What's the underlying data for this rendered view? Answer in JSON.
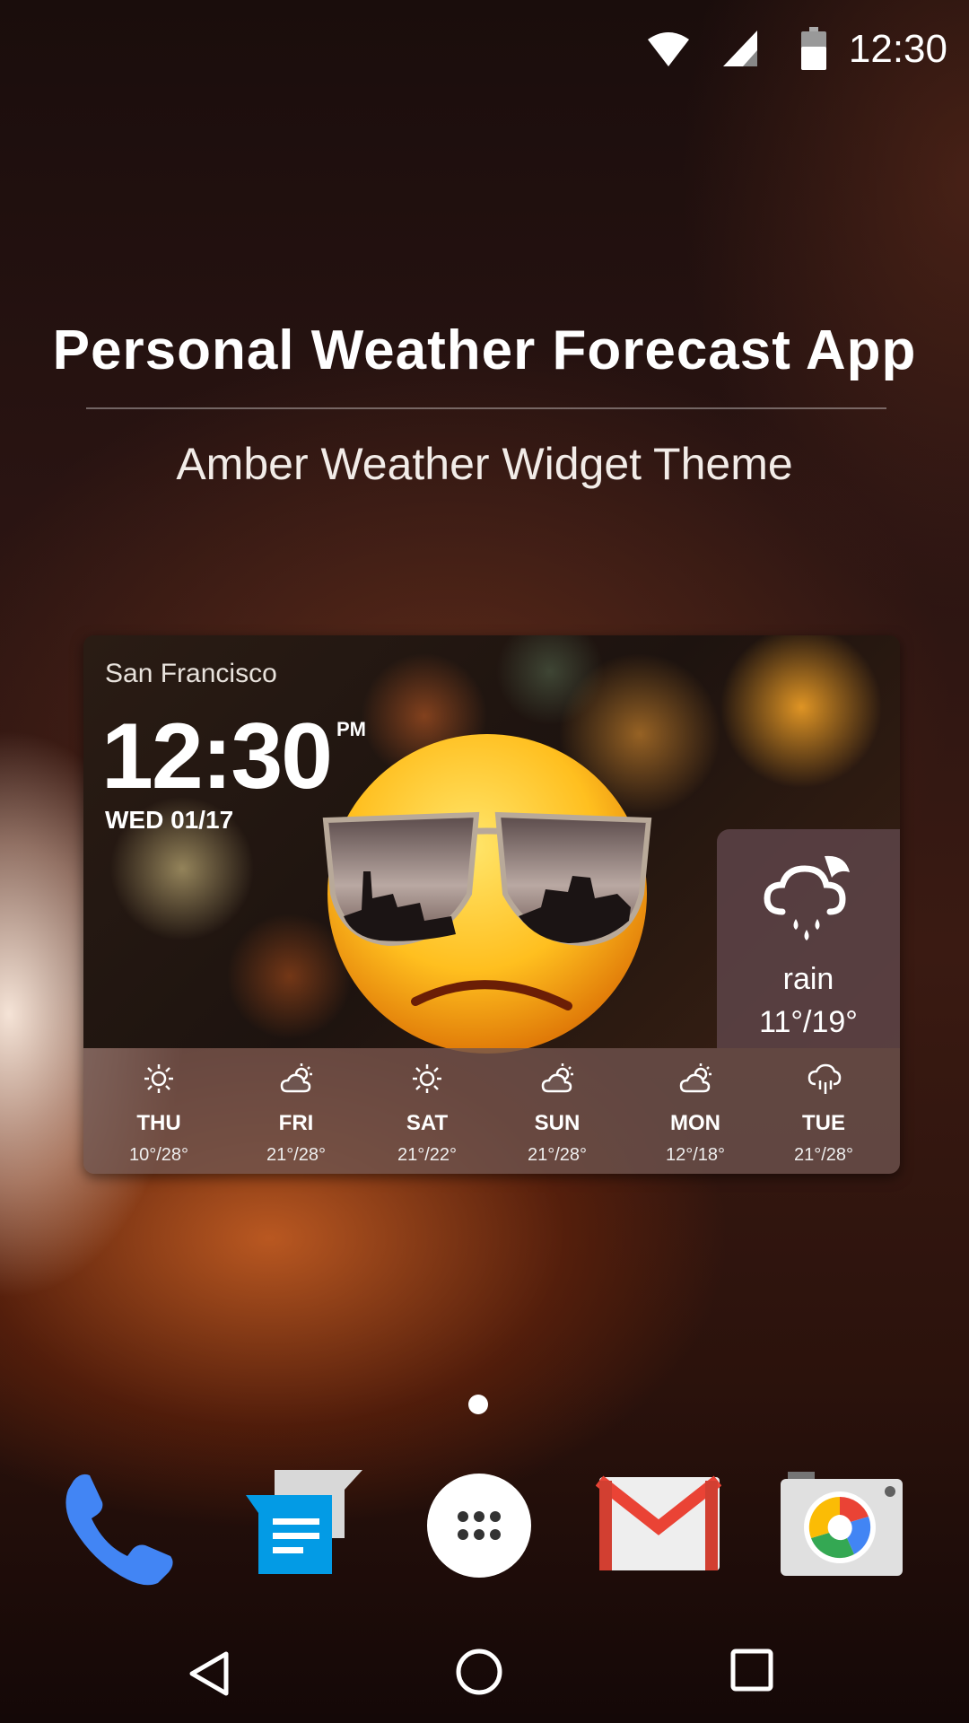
{
  "status_bar": {
    "time": "12:30",
    "icons": [
      "wifi-icon",
      "cell-signal-icon",
      "battery-icon"
    ]
  },
  "promo": {
    "title": "Personal Weather Forecast App",
    "subtitle": "Amber Weather Widget Theme"
  },
  "widget": {
    "city": "San Francisco",
    "time": "12:30",
    "ampm": "PM",
    "date": "WED 01/17",
    "current": {
      "icon": "rain-cloud-moon-icon",
      "condition": "rain",
      "temp_range": "11°/19°"
    },
    "forecast": [
      {
        "day": "THU",
        "temps": "10°/28°",
        "icon": "sun-icon"
      },
      {
        "day": "FRI",
        "temps": "21°/28°",
        "icon": "partly-cloudy-icon"
      },
      {
        "day": "SAT",
        "temps": "21°/22°",
        "icon": "sun-icon"
      },
      {
        "day": "SUN",
        "temps": "21°/28°",
        "icon": "partly-cloudy-icon"
      },
      {
        "day": "MON",
        "temps": "12°/18°",
        "icon": "partly-cloudy-icon"
      },
      {
        "day": "TUE",
        "temps": "21°/28°",
        "icon": "rain-icon"
      }
    ]
  },
  "dock": [
    "phone-app-icon",
    "messages-app-icon",
    "app-drawer-icon",
    "gmail-app-icon",
    "camera-app-icon"
  ],
  "nav": [
    "back-icon",
    "home-icon",
    "recents-icon"
  ],
  "colors": {
    "phone_blue": "#4285f4",
    "gmail_red": "#ea4335",
    "messages_blue": "#039be5"
  }
}
